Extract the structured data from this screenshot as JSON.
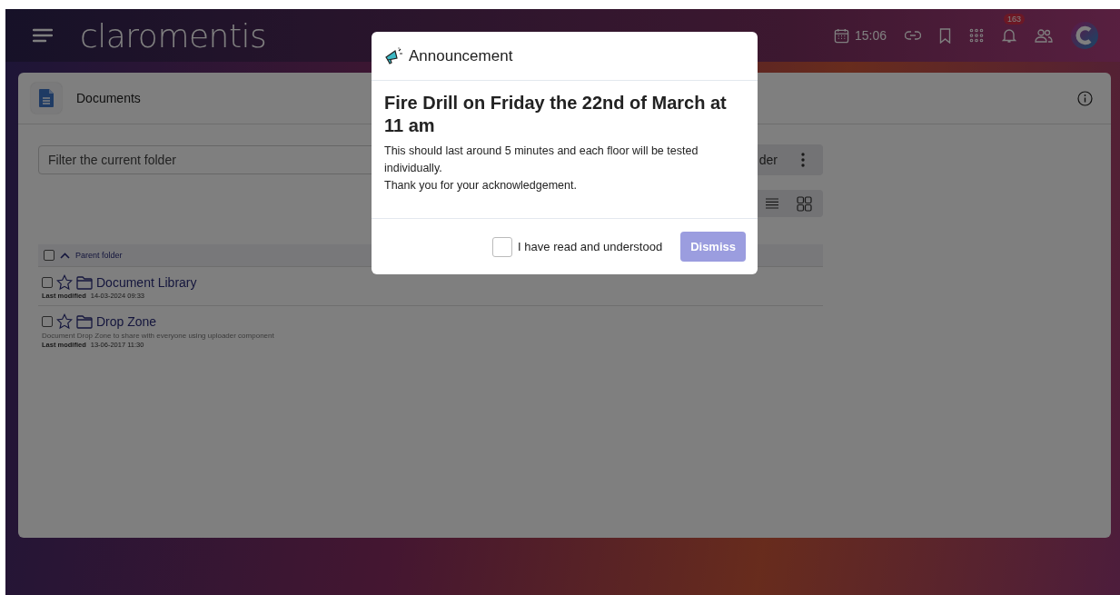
{
  "header": {
    "logo": "claromentis",
    "time": "15:06",
    "notification_count": "163"
  },
  "page": {
    "title": "Documents"
  },
  "filter": {
    "placeholder": "Filter the current folder"
  },
  "folder_button": "der",
  "list": {
    "header": {
      "checked": false,
      "label": "Parent folder"
    },
    "items": [
      {
        "name": "Document Library",
        "checked": false,
        "starred": false,
        "meta_label": "Last modified",
        "meta_value": "14-03-2024 09:33"
      },
      {
        "name": "Drop Zone",
        "checked": false,
        "starred": false,
        "description": "Document Drop Zone to share with everyone using uploader component",
        "meta_label": "Last modified",
        "meta_value": "13-06-2017 11:30"
      }
    ]
  },
  "announcement": {
    "title": "Announcement",
    "heading": "Fire Drill on Friday the 22nd of March at 11 am",
    "body": [
      "This should last around 5 minutes and each floor will be tested individually.",
      "Thank you for your acknowledgement."
    ],
    "acknowledge": {
      "label": "I have read and understood",
      "checked": false
    },
    "button": {
      "label": "Dismiss",
      "disabled": true
    }
  }
}
